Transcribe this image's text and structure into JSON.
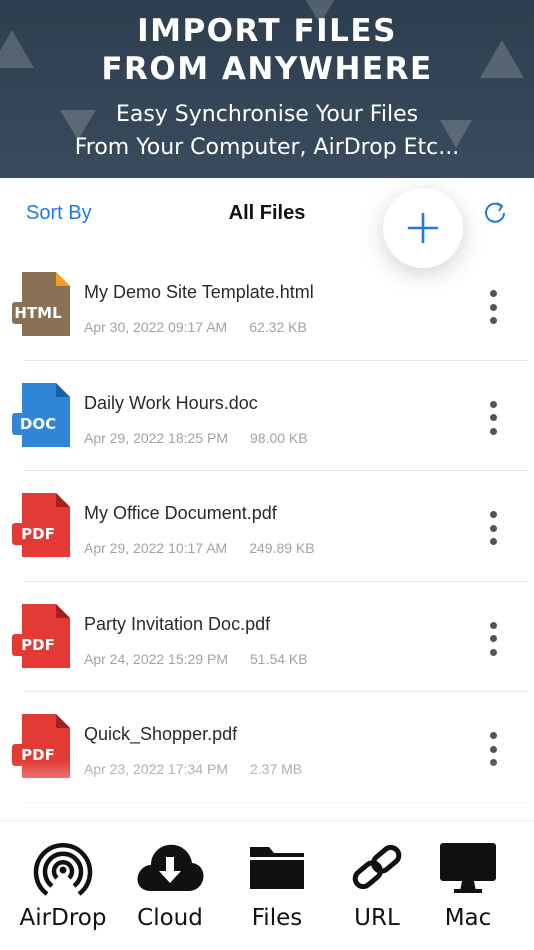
{
  "banner": {
    "title": "IMPORT FILES FROM ANYWHERE",
    "subtitle_line1": "Easy Synchronise Your Files",
    "subtitle_line2": "From Your Computer, AirDrop Etc..."
  },
  "header": {
    "sort_label": "Sort By",
    "title": "All Files"
  },
  "files": [
    {
      "name": "My Demo Site Template.html",
      "date": "Apr 30, 2022 09:17 AM",
      "size": "62.32 KB",
      "type": "HTML",
      "color": "#8a7155",
      "fold": "#f0a11a"
    },
    {
      "name": "Daily Work Hours.doc",
      "date": "Apr 29, 2022 18:25 PM",
      "size": "98.00 KB",
      "type": "DOC",
      "color": "#2f86d6",
      "fold": "#1d5fa3"
    },
    {
      "name": "My Office Document.pdf",
      "date": "Apr 29, 2022 10:17 AM",
      "size": "249.89 KB",
      "type": "PDF",
      "color": "#e43a35",
      "fold": "#a3211d"
    },
    {
      "name": "Party Invitation Doc.pdf",
      "date": "Apr 24, 2022 15:29 PM",
      "size": "51.54 KB",
      "type": "PDF",
      "color": "#e43a35",
      "fold": "#a3211d"
    },
    {
      "name": "Quick_Shopper.pdf",
      "date": "Apr 23, 2022 17:34 PM",
      "size": "2.37 MB",
      "type": "PDF",
      "color": "#e43a35",
      "fold": "#a3211d"
    }
  ],
  "bottom_bar": [
    {
      "label": "AirDrop",
      "icon": "airdrop-icon"
    },
    {
      "label": "Cloud",
      "icon": "cloud-download-icon"
    },
    {
      "label": "Files",
      "icon": "folder-icon"
    },
    {
      "label": "URL",
      "icon": "link-icon"
    },
    {
      "label": "Mac",
      "icon": "monitor-icon"
    }
  ],
  "colors": {
    "accent": "#1f7be0",
    "banner_bg": "#34465a"
  }
}
